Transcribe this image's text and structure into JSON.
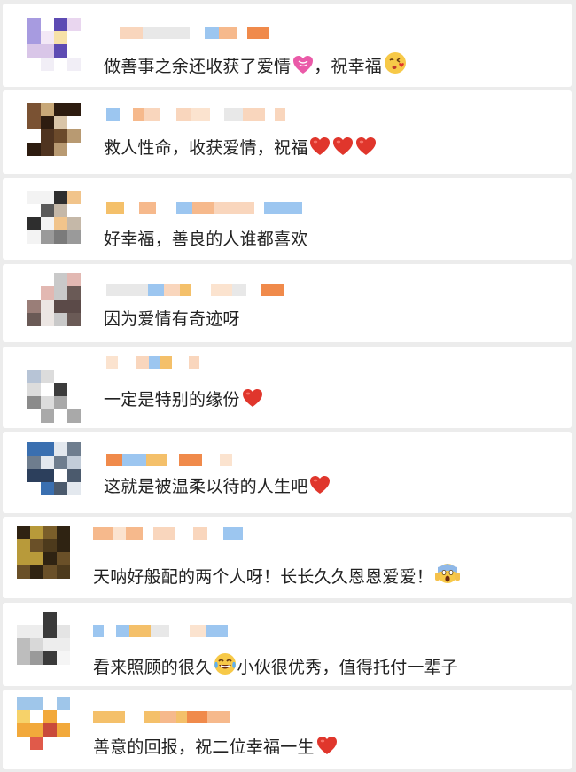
{
  "comments": [
    {
      "text": "做善事之余还收获了爱情",
      "suffix": "，祝幸福",
      "emojis": [
        "pink-heart",
        "kiss-face"
      ]
    },
    {
      "text": "救人性命，收获爱情，祝福",
      "suffix": "",
      "emojis": [
        "red-heart",
        "red-heart",
        "red-heart"
      ]
    },
    {
      "text": "好幸福，善良的人谁都喜欢",
      "suffix": "",
      "emojis": []
    },
    {
      "text": "因为爱情有奇迹呀",
      "suffix": "",
      "emojis": []
    },
    {
      "text": "一定是特别的缘份",
      "suffix": "",
      "emojis": [
        "red-heart"
      ]
    },
    {
      "text": "这就是被温柔以待的人生吧",
      "suffix": "",
      "emojis": [
        "red-heart"
      ]
    },
    {
      "text": "天呐好般配的两个人呀！长长久久恩恩爱爱！",
      "suffix": "",
      "emojis": [
        "screaming-face"
      ]
    },
    {
      "text": "看来照顾的很久",
      "suffix": "小伙很优秀，值得托付一辈子",
      "emojis": [
        "laughing-tears-face"
      ]
    },
    {
      "text": "善意的回报，祝二位幸福一生",
      "suffix": "",
      "emojis": [
        "red-heart"
      ]
    }
  ],
  "colors": {
    "accent_orange": "#f08a4b",
    "accent_blue": "#9cc6f0",
    "heart_red": "#e0362c",
    "pink_heart": "#ea5aa8",
    "emoji_yellow": "#f7c948"
  }
}
